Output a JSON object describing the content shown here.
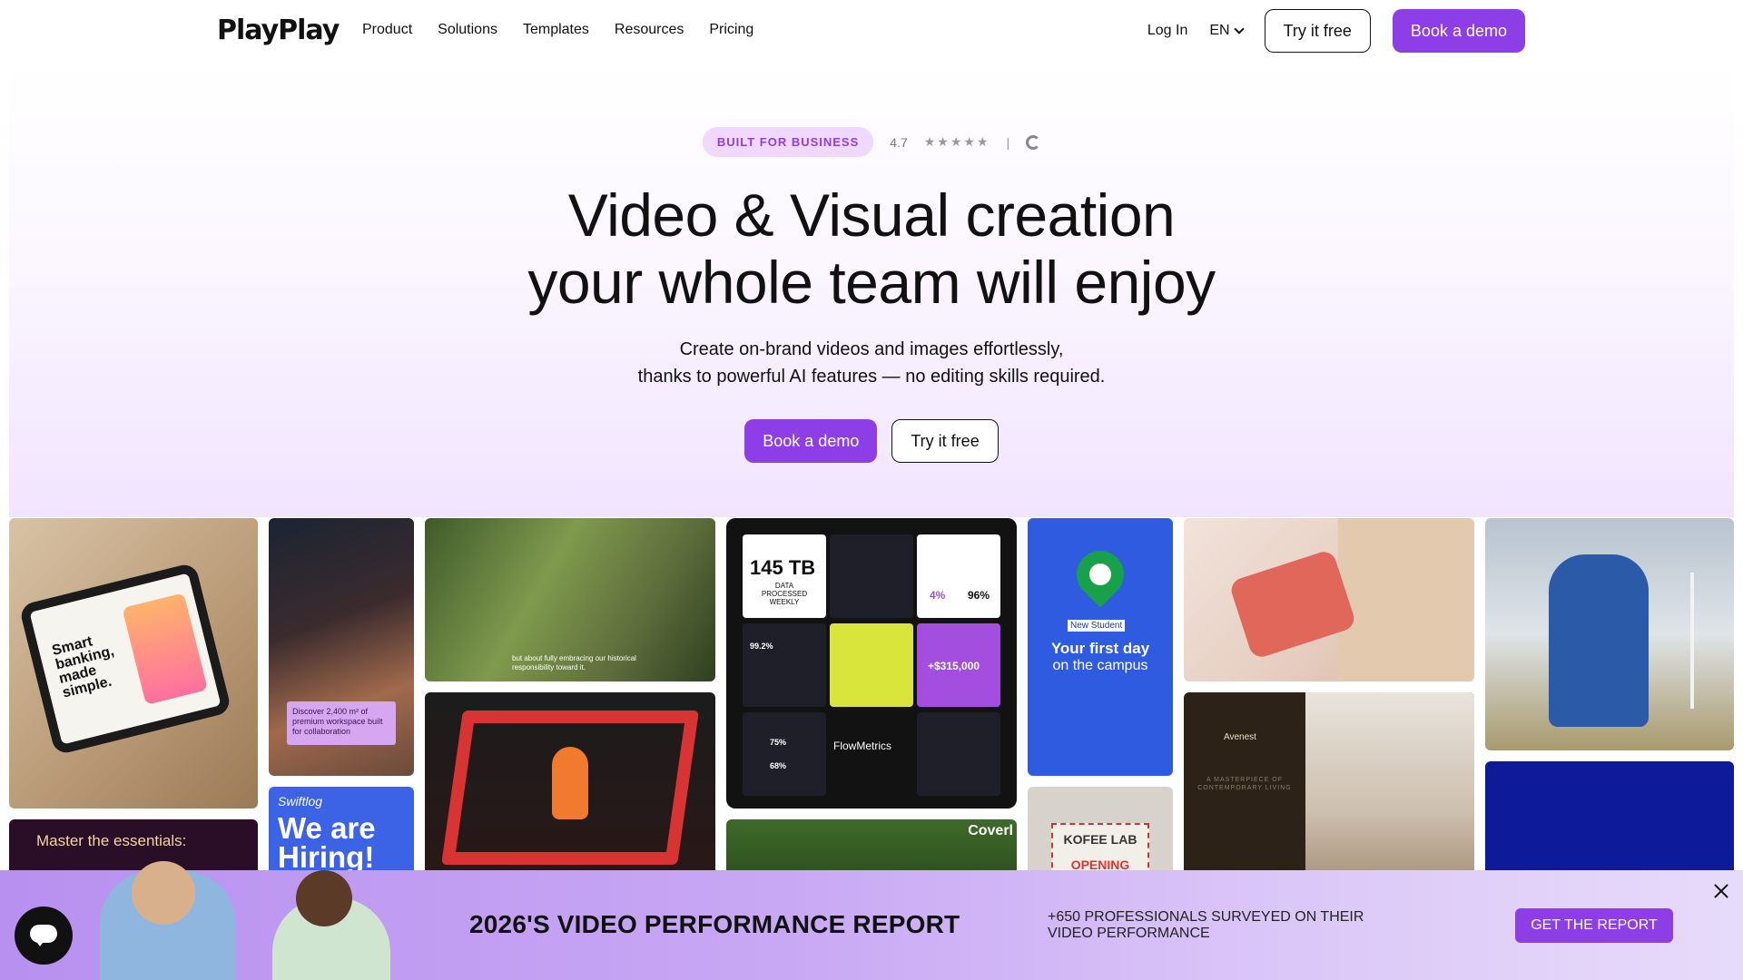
{
  "nav": {
    "logo": "PlayPlay",
    "links": [
      "Product",
      "Solutions",
      "Templates",
      "Resources",
      "Pricing"
    ],
    "login": "Log In",
    "lang": "EN",
    "try_free": "Try it free",
    "book_demo": "Book a demo"
  },
  "hero": {
    "badge": "BUILT FOR BUSINESS",
    "rating": "4.7",
    "stars": "★★★★★",
    "separator": "|",
    "title_line1": "Video & Visual creation",
    "title_line2": "your whole team will enjoy",
    "sub_line1": "Create on-brand videos and images effortlessly,",
    "sub_line2": "thanks to powerful AI features — no editing skills required.",
    "cta_demo": "Book a demo",
    "cta_try": "Try it free"
  },
  "gallery": {
    "tablet_text": "Smart banking, made simple.",
    "master": "Master the essentials:",
    "building_note": "Discover 2,400 m² of premium workspace built for collaboration",
    "hiring_brand": "Swiftlog",
    "hiring_text": "We are Hiring!",
    "birder_caption": "but about fully embracing our historical responsibility toward it.",
    "dash_tb_big": "145 TB",
    "dash_tb_small": "DATA PROCESSED WEEKLY",
    "dash_pct1": "4%",
    "dash_pct2": "96%",
    "dash_money": "+$315,000",
    "dash_pct3": "99.2%",
    "dash_pct4": "75%",
    "dash_pct5": "68%",
    "dash_brand": "FlowMetrics",
    "campus_tag": "New Student",
    "campus_title": "Your first day",
    "campus_sub": "on the campus",
    "kofee": "KOFEE LAB",
    "kofee_open": "OPENING",
    "avenest_brand": "Avenest",
    "avenest_line": "A MASTERPIECE OF CONTEMPORARY LIVING",
    "coverall": "Coverl"
  },
  "banner": {
    "title": "2026'S VIDEO PERFORMANCE REPORT",
    "desc": "+650 PROFESSIONALS SURVEYED ON THEIR VIDEO PERFORMANCE",
    "button": "GET THE REPORT"
  },
  "colors": {
    "brand_purple": "#8e3ee6",
    "badge_bg": "#f1d8ff"
  }
}
